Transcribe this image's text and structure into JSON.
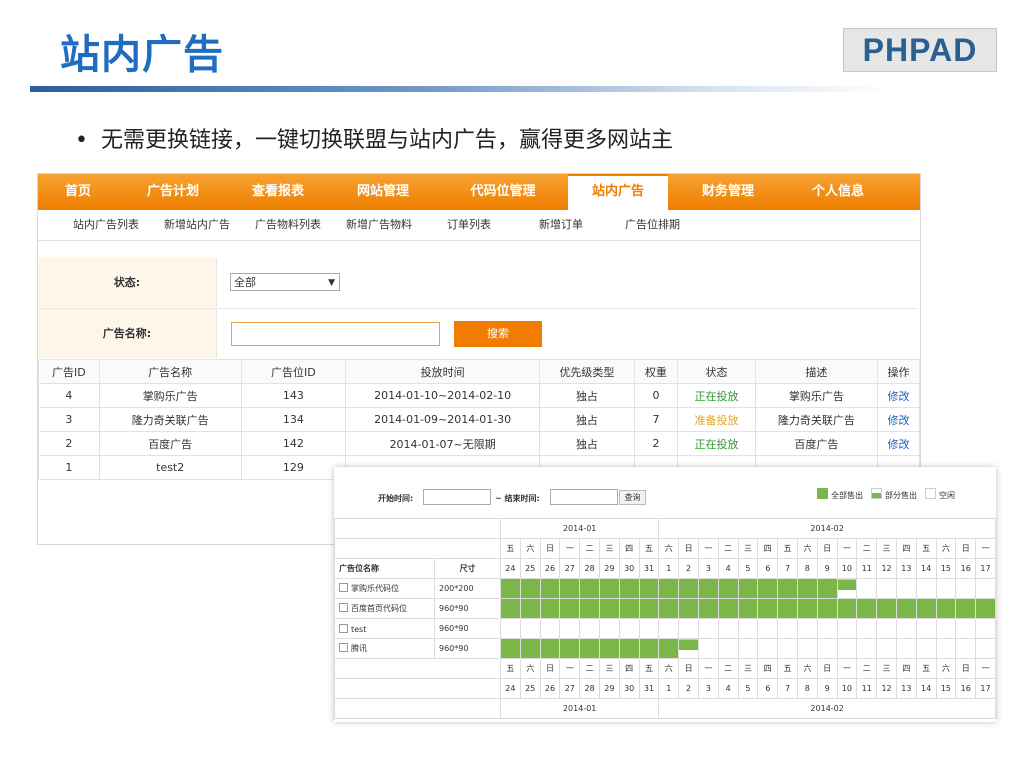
{
  "slide": {
    "title": "站内广告",
    "logo": "PHPAD",
    "bullet": "无需更换链接，一键切换联盟与站内广告，赢得更多网站主"
  },
  "topnav": [
    {
      "label": "首页",
      "active": false
    },
    {
      "label": "广告计划",
      "active": false
    },
    {
      "label": "查看报表",
      "active": false
    },
    {
      "label": "网站管理",
      "active": false
    },
    {
      "label": "代码位管理",
      "active": false
    },
    {
      "label": "站内广告",
      "active": true
    },
    {
      "label": "财务管理",
      "active": false
    },
    {
      "label": "个人信息",
      "active": false
    }
  ],
  "subnav": [
    "站内广告列表",
    "新增站内广告",
    "广告物料列表",
    "新增广告物料",
    "订单列表",
    "新增订单",
    "广告位排期"
  ],
  "filter": {
    "status_label": "状态:",
    "status_value": "全部",
    "name_label": "广告名称:",
    "name_value": "",
    "search_button": "搜索"
  },
  "ads_table": {
    "headers": [
      "广告ID",
      "广告名称",
      "广告位ID",
      "投放时间",
      "优先级类型",
      "权重",
      "状态",
      "描述",
      "操作"
    ],
    "rows": [
      [
        "4",
        "掌购乐广告",
        "143",
        "2014-01-10~2014-02-10",
        "独占",
        "0",
        "正在投放",
        "掌购乐广告",
        "修改"
      ],
      [
        "3",
        "隆力奇关联广告",
        "134",
        "2014-01-09~2014-01-30",
        "独占",
        "7",
        "准备投放",
        "隆力奇关联广告",
        "修改"
      ],
      [
        "2",
        "百度广告",
        "142",
        "2014-01-07~无限期",
        "独占",
        "2",
        "正在投放",
        "百度广告",
        "修改"
      ],
      [
        "1",
        "test2",
        "129",
        "",
        "",
        "",
        "",
        "",
        ""
      ]
    ]
  },
  "colors": {
    "nav": "#f08a10",
    "active_status": "#2e9b2e",
    "pending_status": "#e8a21f",
    "booked": "#7ab648",
    "title": "#1f6dbf"
  },
  "calendar": {
    "start_label": "开始时间:",
    "end_label": "~ 结束时间:",
    "query_button": "查询",
    "legend": [
      "全部售出",
      "部分售出",
      "空闲"
    ],
    "slot_header": "广告位名称",
    "size_header": "尺寸",
    "month1": "2014-01",
    "month2": "2014-02",
    "weekdays": [
      "五",
      "六",
      "日",
      "一",
      "二",
      "三",
      "四",
      "五",
      "六",
      "日",
      "一",
      "二",
      "三",
      "四",
      "五",
      "六",
      "日",
      "一",
      "二",
      "三",
      "四",
      "五",
      "六",
      "日",
      "一"
    ],
    "days": [
      "24",
      "25",
      "26",
      "27",
      "28",
      "29",
      "30",
      "31",
      "1",
      "2",
      "3",
      "4",
      "5",
      "6",
      "7",
      "8",
      "9",
      "10",
      "11",
      "12",
      "13",
      "14",
      "15",
      "16",
      "17"
    ],
    "slots": [
      {
        "name": "掌购乐代码位",
        "size": "200*200",
        "booked_until": "2014-02-09",
        "partial": "2014-02-10"
      },
      {
        "name": "百度首页代码位",
        "size": "960*90",
        "booked_until": "2014-02-17",
        "partial": ""
      },
      {
        "name": "test",
        "size": "960*90",
        "booked_until": "",
        "partial": ""
      },
      {
        "name": "腾讯",
        "size": "960*90",
        "booked_until": "2014-02-01",
        "partial": "2014-02-02"
      }
    ]
  }
}
